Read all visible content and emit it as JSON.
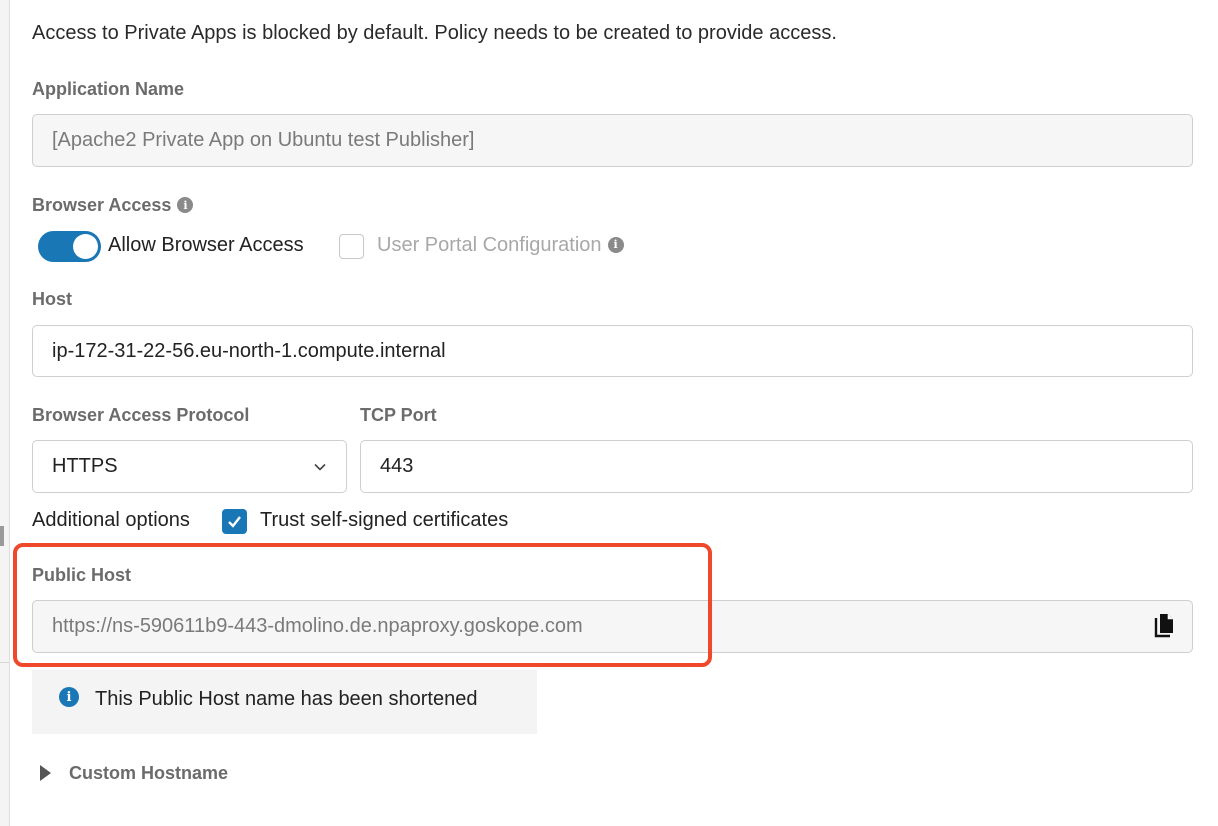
{
  "intro_text": "Access to Private Apps is blocked by default. Policy needs to be created to provide access.",
  "application_name": {
    "label": "Application Name",
    "value": "[Apache2 Private App on Ubuntu test Publisher]"
  },
  "browser_access": {
    "label": "Browser Access",
    "info_icon": "info-icon",
    "toggle_label": "Allow Browser Access",
    "toggle_on": true,
    "portal_label": "User Portal Configuration",
    "portal_checked": false
  },
  "host": {
    "label": "Host",
    "value": "ip-172-31-22-56.eu-north-1.compute.internal"
  },
  "protocol": {
    "label": "Browser Access Protocol",
    "selected": "HTTPS"
  },
  "tcp_port": {
    "label": "TCP Port",
    "value": "443"
  },
  "additional_options": {
    "label": "Additional options",
    "trust_label": "Trust self-signed certificates",
    "trust_checked": true
  },
  "public_host": {
    "label": "Public Host",
    "value": "https://ns-590611b9-443-dmolino.de.npaproxy.goskope.com",
    "copy_icon": "copy-icon"
  },
  "notice": {
    "text": "This Public Host name has been shortened"
  },
  "custom_hostname": {
    "label": "Custom Hostname"
  },
  "colors": {
    "accent": "#1a77b6",
    "highlight": "#f0482a"
  }
}
